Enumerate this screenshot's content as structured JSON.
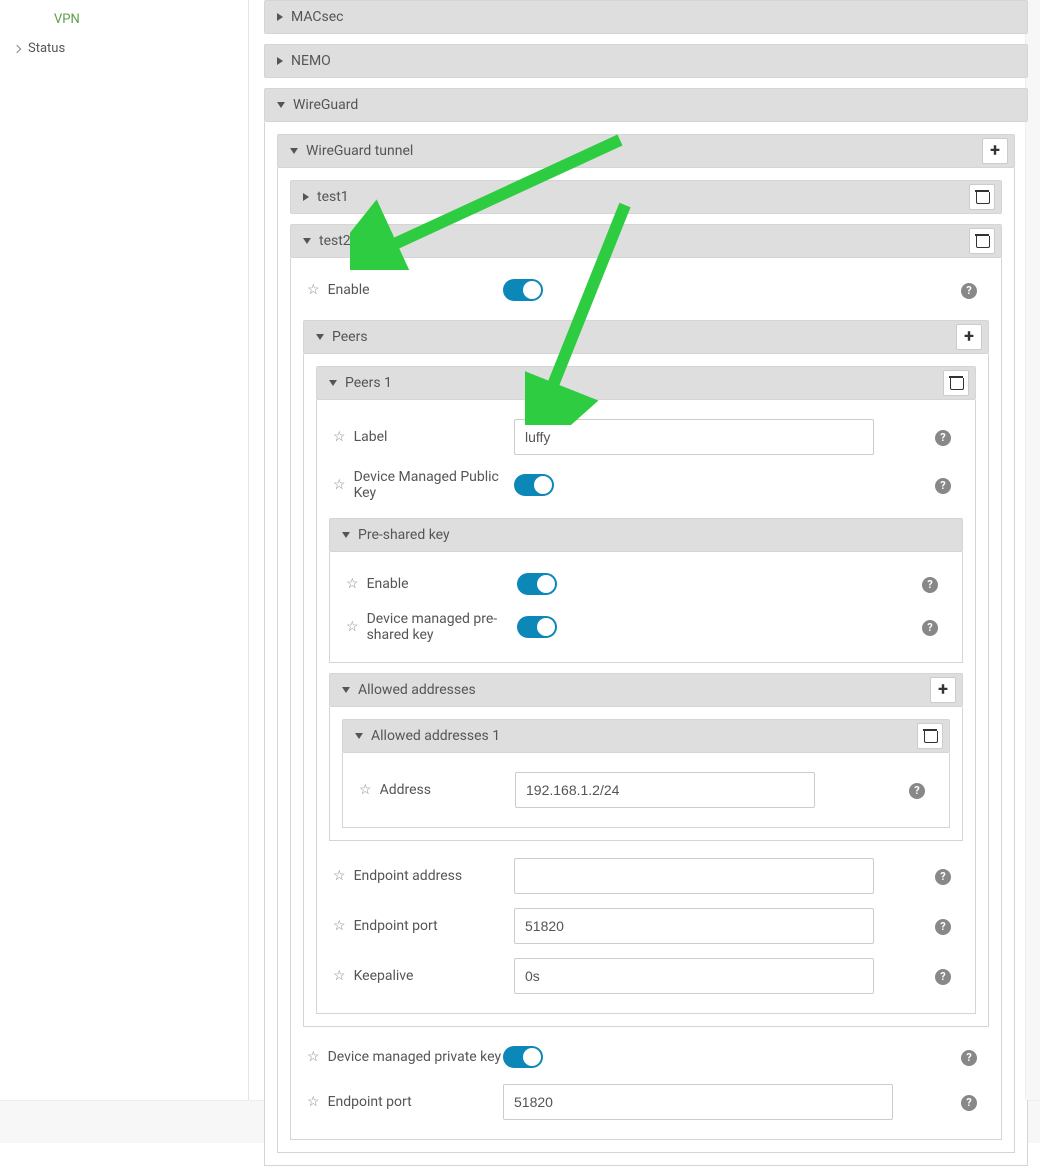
{
  "sidebar": {
    "vpn": "VPN",
    "status": "Status"
  },
  "sections": {
    "macsec": "MACsec",
    "nemo": "NEMO",
    "wireguard": "WireGuard"
  },
  "wg": {
    "tunnel_header": "WireGuard tunnel",
    "tunnels": {
      "t1": "test1",
      "t2": "test2"
    },
    "enable_label": "Enable",
    "peers_header": "Peers",
    "peer1_header": "Peers 1",
    "peer": {
      "label_label": "Label",
      "label_value": "luffy",
      "dev_pubkey_label": "Device Managed Public Key",
      "psk_header": "Pre-shared key",
      "psk_enable_label": "Enable",
      "psk_managed_label": "Device managed pre-shared key",
      "allowed_header": "Allowed addresses",
      "allowed1_header": "Allowed addresses 1",
      "address_label": "Address",
      "address_value": "192.168.1.2/24",
      "endpoint_addr_label": "Endpoint address",
      "endpoint_addr_value": "",
      "endpoint_port_label": "Endpoint port",
      "endpoint_port_value": "51820",
      "keepalive_label": "Keepalive",
      "keepalive_value": "0s"
    },
    "tunnel": {
      "dev_privkey_label": "Device managed private key",
      "endpoint_port_label": "Endpoint port",
      "endpoint_port_value": "51820"
    }
  }
}
